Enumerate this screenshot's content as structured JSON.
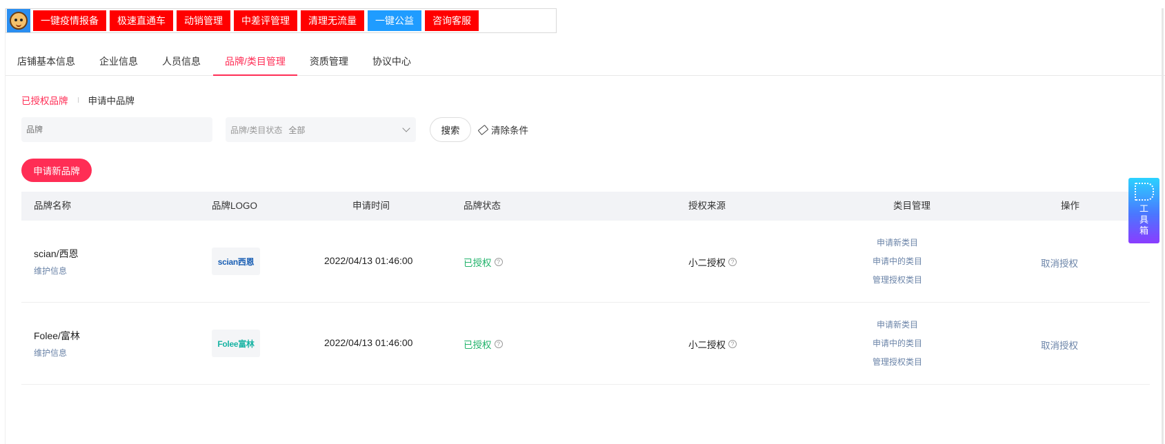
{
  "toolbar": {
    "buttons": [
      {
        "label": "一键疫情报备",
        "color": "#ff0000"
      },
      {
        "label": "极速直通车",
        "color": "#ff0000"
      },
      {
        "label": "动销管理",
        "color": "#ff0000"
      },
      {
        "label": "中差评管理",
        "color": "#ff0000"
      },
      {
        "label": "清理无流量",
        "color": "#ff0000"
      },
      {
        "label": "一键公益",
        "color": "#1f9cff"
      },
      {
        "label": "咨询客服",
        "color": "#ff0000"
      }
    ]
  },
  "tabs": [
    "店铺基本信息",
    "企业信息",
    "人员信息",
    "品牌/类目管理",
    "资质管理",
    "协议中心"
  ],
  "active_tab": "品牌/类目管理",
  "subtabs": {
    "authorized": "已授权品牌",
    "applying": "申请中品牌"
  },
  "filters": {
    "brand_placeholder": "品牌",
    "status_label": "品牌/类目状态",
    "status_value": "全部",
    "search_label": "搜索",
    "clear_label": "清除条件"
  },
  "apply_button": "申请新品牌",
  "table": {
    "headers": [
      "品牌名称",
      "品牌LOGO",
      "申请时间",
      "品牌状态",
      "授权来源",
      "类目管理",
      "操作"
    ],
    "rows": [
      {
        "name": "scian/西恩",
        "maintain": "维护信息",
        "logo": "scian西恩",
        "time": "2022/04/13 01:46:00",
        "status": "已授权",
        "source": "小二授权",
        "cat_links": [
          "申请新类目",
          "申请中的类目",
          "管理授权类目"
        ],
        "op": "取消授权"
      },
      {
        "name": "Folee/富林",
        "maintain": "维护信息",
        "logo": "Folee富林",
        "time": "2022/04/13 01:46:00",
        "status": "已授权",
        "source": "小二授权",
        "cat_links": [
          "申请新类目",
          "申请中的类目",
          "管理授权类目"
        ],
        "op": "取消授权"
      }
    ]
  },
  "toolbox_label": "工具箱",
  "colors": {
    "accent": "#ff2d55",
    "status_green": "#22b36b",
    "link": "#6b84a8"
  }
}
